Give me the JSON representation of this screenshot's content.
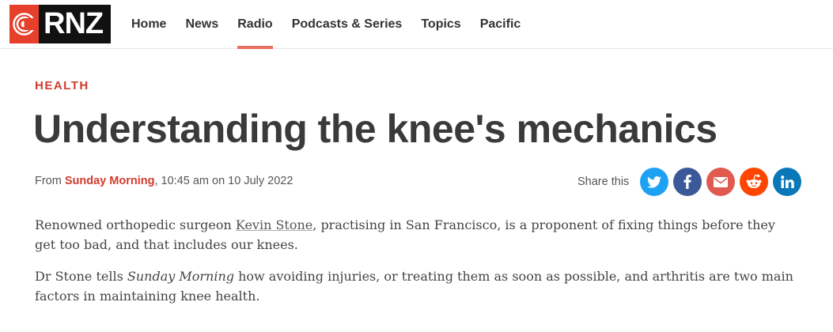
{
  "brand": {
    "logo_text": "RNZ"
  },
  "nav": {
    "items": [
      {
        "label": "Home",
        "active": false
      },
      {
        "label": "News",
        "active": false
      },
      {
        "label": "Radio",
        "active": true
      },
      {
        "label": "Podcasts & Series",
        "active": false
      },
      {
        "label": "Topics",
        "active": false
      },
      {
        "label": "Pacific",
        "active": false
      }
    ]
  },
  "article": {
    "section": "HEALTH",
    "title": "Understanding the knee's mechanics",
    "meta": {
      "from_prefix": "From",
      "programme": "Sunday Morning",
      "timestamp": ", 10:45 am on 10 July 2022"
    },
    "share": {
      "label": "Share this",
      "buttons": [
        {
          "name": "twitter",
          "color": "#1da1f2"
        },
        {
          "name": "facebook",
          "color": "#3b5998"
        },
        {
          "name": "email",
          "color": "#e05a4f"
        },
        {
          "name": "reddit",
          "color": "#ff4500"
        },
        {
          "name": "linkedin",
          "color": "#0a78b8"
        }
      ]
    },
    "paragraphs": {
      "p1_before": "Renowned orthopedic surgeon ",
      "p1_link": "Kevin Stone",
      "p1_after": ", practising in San Francisco, is a proponent of fixing things before they get too bad, and that includes our knees.",
      "p2_before": "Dr Stone tells ",
      "p2_em": "Sunday Morning",
      "p2_after": " how avoiding injuries, or treating them as soon as possible, and arthritis are two main factors in maintaining knee health."
    }
  },
  "colors": {
    "accent_red": "#d13c2e",
    "nav_underline": "#e8705e",
    "logo_red": "#e63f2b"
  }
}
